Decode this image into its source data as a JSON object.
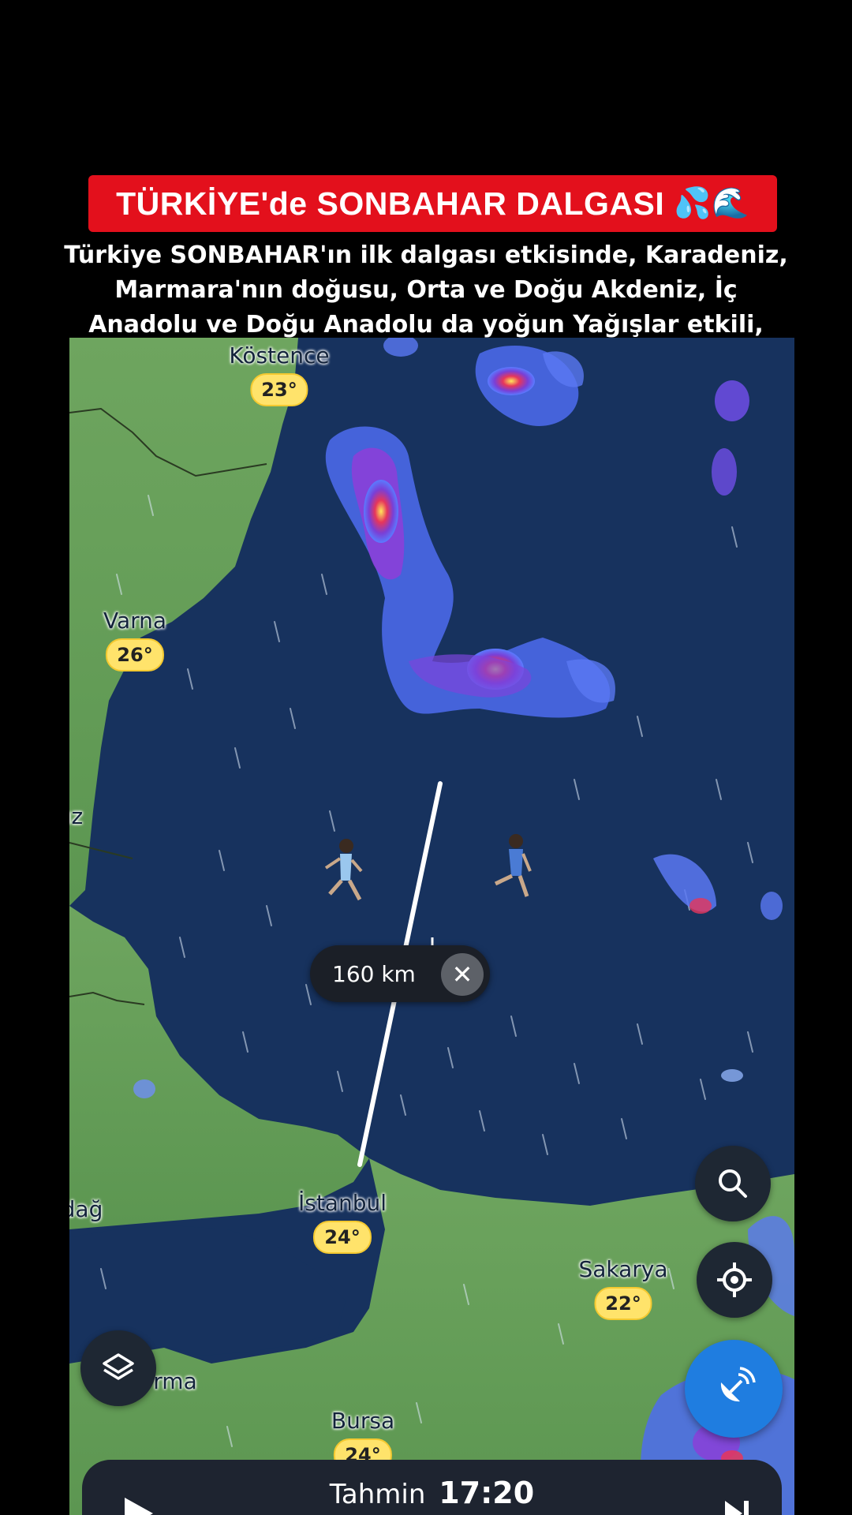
{
  "banner": {
    "title": "TÜRKİYE'de SONBAHAR DALGASI",
    "emoji": "💦🌊"
  },
  "subtitle": "Türkiye SONBAHAR'ın ilk dalgası etkisinde, Karadeniz, Marmara'nın doğusu, Orta ve Doğu Akdeniz, İç Anadolu ve Doğu Anadolu da yoğun Yağışlar etkili, DİKKAT 💦🌊⚠️",
  "map": {
    "cities": [
      {
        "name": "Köstence",
        "temp": "23°"
      },
      {
        "name": "Varna",
        "temp": "26°"
      },
      {
        "name": "İstanbul",
        "temp": "24°"
      },
      {
        "name": "Sakarya",
        "temp": "22°"
      },
      {
        "name": "Bursa",
        "temp": "24°"
      }
    ],
    "partial_labels": [
      "ız",
      "dağ",
      "rma"
    ],
    "distance": "160 km",
    "colors": {
      "sea": "#14305a",
      "land": "#5f9a56",
      "accent": "#1f7de0"
    }
  },
  "controls": {
    "search_icon": "search-icon",
    "locate_icon": "locate-icon",
    "layers_icon": "layers-icon",
    "radar_icon": "radar-dish-icon"
  },
  "bottom": {
    "label": "Tahmin",
    "time": "17:20"
  }
}
